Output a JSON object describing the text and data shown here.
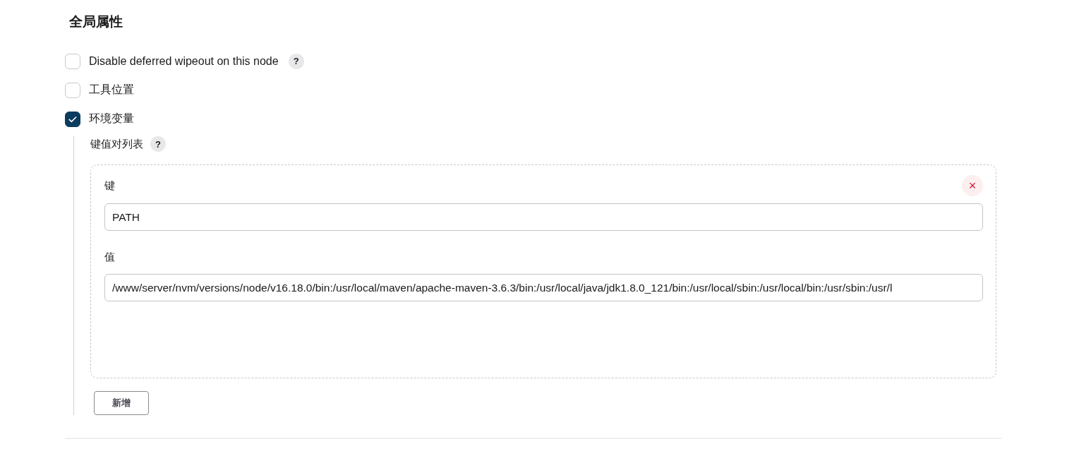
{
  "section_title": "全局属性",
  "options": [
    {
      "label": "Disable deferred wipeout on this node",
      "checked": false,
      "help": "?"
    },
    {
      "label": "工具位置",
      "checked": false
    },
    {
      "label": "环境变量",
      "checked": true
    }
  ],
  "env": {
    "list_label": "键值对列表",
    "help": "?",
    "entries": [
      {
        "key_label": "键",
        "key": "PATH",
        "value_label": "值",
        "value": "/www/server/nvm/versions/node/v16.18.0/bin:/usr/local/maven/apache-maven-3.6.3/bin:/usr/local/java/jdk1.8.0_121/bin:/usr/local/sbin:/usr/local/bin:/usr/sbin:/usr/l",
        "remove": "×"
      }
    ],
    "add_button": "新增"
  }
}
